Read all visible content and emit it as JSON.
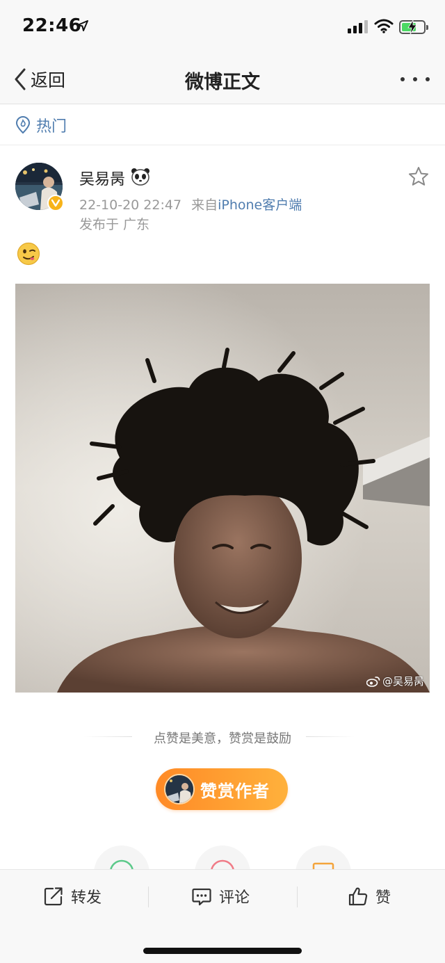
{
  "status_bar": {
    "time": "22:46",
    "colors": {
      "battery_fill": "#4cd964"
    }
  },
  "nav": {
    "back_label": "返回",
    "title": "微博正文"
  },
  "hot": {
    "label": "热门"
  },
  "post": {
    "user_name": "吴易昺",
    "timestamp": "22-10-20 22:47",
    "source_prefix": "来自",
    "source": "iPhone客户端",
    "location": "发布于 广东",
    "emoji_icon": "smirk-tongue-emoji",
    "watermark": "@吴易昺"
  },
  "reward": {
    "tagline": "点赞是美意，赞赏是鼓励",
    "button_label": "赞赏作者"
  },
  "toolbar": {
    "repost_label": "转发",
    "comment_label": "评论",
    "like_label": "赞"
  },
  "theme": {
    "link_blue": "#507daf",
    "verified_badge": "#f7b319",
    "reward_gradient_start": "#ff8a26",
    "reward_gradient_end": "#ffb13c"
  }
}
